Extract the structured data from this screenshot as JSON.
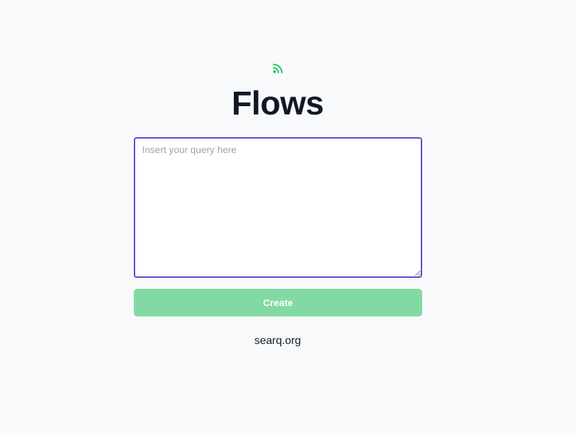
{
  "app": {
    "icon": "rss-icon",
    "icon_color": "#22c55e",
    "title": "Flows"
  },
  "query": {
    "placeholder": "Insert your query here",
    "value": "",
    "border_color": "#5b46c9"
  },
  "create_button": {
    "label": "Create",
    "color": "#83d9a3"
  },
  "footer": {
    "link_text": "searq.org"
  }
}
